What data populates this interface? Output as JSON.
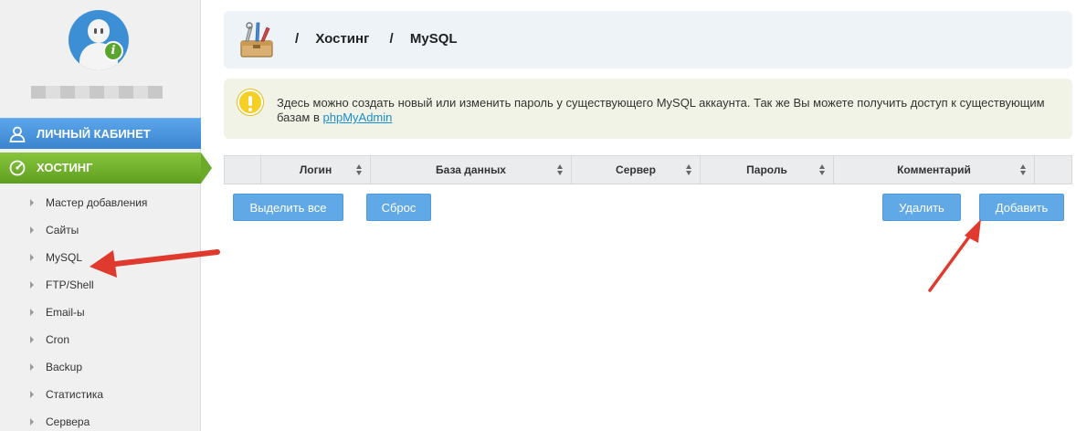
{
  "sidebar": {
    "menu_cabinet": "ЛИЧНЫЙ КАБИНЕТ",
    "menu_hosting": "ХОСТИНГ",
    "items": [
      {
        "label": "Мастер добавления"
      },
      {
        "label": "Сайты"
      },
      {
        "label": "MySQL"
      },
      {
        "label": "FTP/Shell"
      },
      {
        "label": "Email-ы"
      },
      {
        "label": "Cron"
      },
      {
        "label": "Backup"
      },
      {
        "label": "Статистика"
      },
      {
        "label": "Сервера"
      }
    ]
  },
  "breadcrumb": {
    "separator": "/",
    "items": [
      "Хостинг",
      "MySQL"
    ]
  },
  "notice": {
    "text": "Здесь можно создать новый или изменить пароль у существующего MySQL аккаунта. Так же Вы можете получить доступ к существующим базам в ",
    "link": "phpMyAdmin"
  },
  "table": {
    "columns": [
      "Логин",
      "База данных",
      "Сервер",
      "Пароль",
      "Комментарий"
    ]
  },
  "buttons": {
    "select_all": "Выделить все",
    "reset": "Сброс",
    "delete": "Удалить",
    "add": "Добавить"
  },
  "colors": {
    "accent_blue": "#61a9e6",
    "hosting_green": "#6aaa28",
    "annotation_red": "#e03a2f"
  }
}
